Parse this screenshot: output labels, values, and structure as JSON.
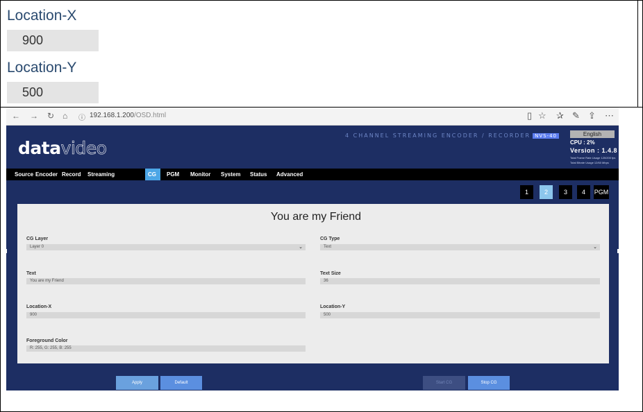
{
  "callouts": {
    "location_x_label": "Location-X",
    "location_x_value": "900",
    "location_y_label": "Location-Y",
    "location_y_value": "500"
  },
  "browser": {
    "url_host": "192.168.1.200",
    "url_path": "/OSD.html"
  },
  "header": {
    "logo_bold": "data",
    "logo_thin": "video",
    "product_title": "4 CHANNEL STREAMING ENCODER / RECORDER",
    "model_badge": "NVS-40",
    "language": "English",
    "cpu": "CPU : 2%",
    "version": "Version : 1.4.8",
    "frame_rate": "Total Frame Rate Usage 120/200 fps",
    "bitrate": "Total Bitrate Usage 12/60 Mbps"
  },
  "menu": [
    "Source",
    "Encoder",
    "Record",
    "Streaming",
    "CG",
    "PGM",
    "Monitor",
    "System",
    "Status",
    "Advanced"
  ],
  "menu_active": "CG",
  "pages": [
    "1",
    "2",
    "3",
    "4",
    "PGM"
  ],
  "pages_active": "2",
  "panel": {
    "title": "You are my Friend",
    "cg_layer_label": "CG Layer",
    "cg_layer_value": "Layer 0",
    "cg_type_label": "CG Type",
    "cg_type_value": "Text",
    "text_label": "Text",
    "text_value": "You are my Friend",
    "text_size_label": "Text Size",
    "text_size_value": "36",
    "loc_x_label": "Location-X",
    "loc_x_value": "900",
    "loc_y_label": "Location-Y",
    "loc_y_value": "500",
    "fg_color_label": "Foreground Color",
    "fg_color_value": "R: 255, G: 255, B: 255"
  },
  "buttons": {
    "apply": "Apply",
    "default": "Default",
    "start_cg": "Start CG",
    "stop_cg": "Stop CG"
  },
  "colors": {
    "page_bg": "#1d2e63",
    "accent": "#4ca6e6"
  }
}
